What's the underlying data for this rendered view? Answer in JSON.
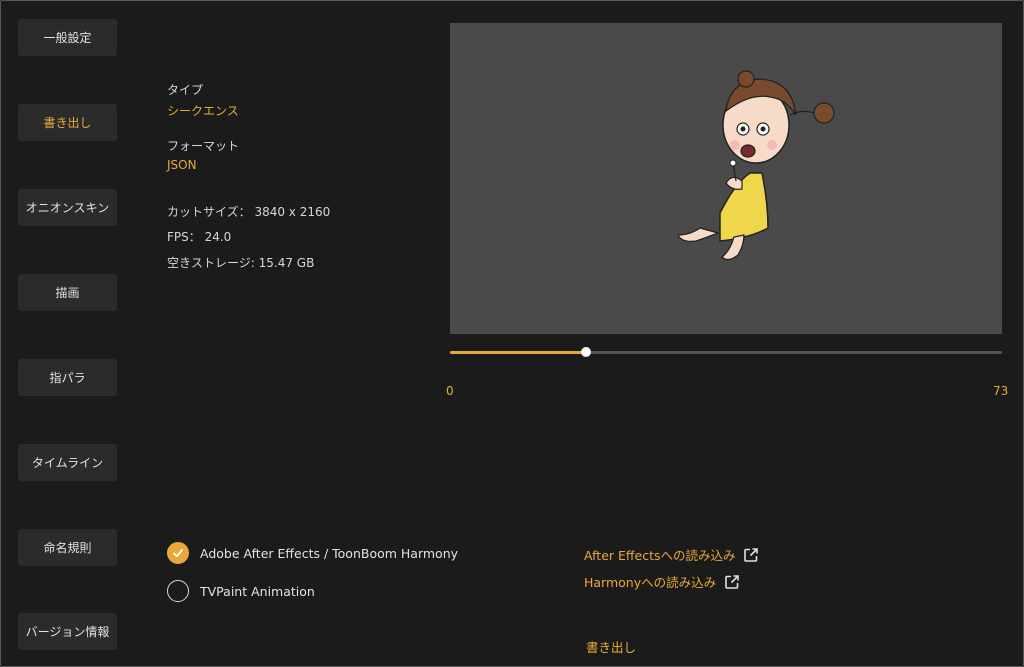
{
  "sidebar": {
    "items": [
      {
        "label": "一般設定",
        "active": false
      },
      {
        "label": "書き出し",
        "active": true
      },
      {
        "label": "オニオンスキン",
        "active": false
      },
      {
        "label": "描画",
        "active": false
      },
      {
        "label": "指パラ",
        "active": false
      },
      {
        "label": "タイムライン",
        "active": false
      },
      {
        "label": "命名規則",
        "active": false
      },
      {
        "label": "バージョン情報",
        "active": false
      }
    ]
  },
  "info": {
    "type_label": "タイプ",
    "type_value": "シークエンス",
    "format_label": "フォーマット",
    "format_value": "JSON",
    "cut_size": "カットサイズ： 3840 x 2160",
    "fps": "FPS： 24.0",
    "storage": "空きストレージ: 15.47 GB"
  },
  "timeline": {
    "min": "0",
    "max": "73",
    "position_fraction": 0.246
  },
  "export_options": [
    {
      "label": "Adobe After Effects / ToonBoom Harmony",
      "checked": true
    },
    {
      "label": "TVPaint Animation",
      "checked": false
    }
  ],
  "links": [
    {
      "label": "After Effectsへの読み込み",
      "icon": "external-link-icon"
    },
    {
      "label": "Harmonyへの読み込み",
      "icon": "external-link-icon"
    }
  ],
  "export_button": "書き出し",
  "colors": {
    "accent": "#e8a93a",
    "background": "#1b1b1b",
    "button": "#2b2b2b",
    "preview_bg": "#4a4a4a"
  }
}
